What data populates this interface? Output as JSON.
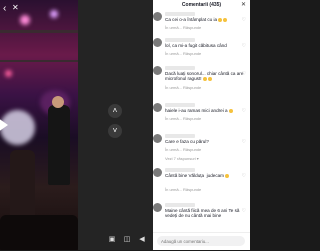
{
  "header": {
    "title": "Comentarii (435)"
  },
  "comments": [
    {
      "text": "Ca cei o-a întâmplat cu ia",
      "emoji": 2,
      "meta": "În urmă...   Răspunde"
    },
    {
      "text": "lol, ca mi-a fugit căbitusa când",
      "emoji": 0,
      "meta": "În urmă...   Răspunde"
    },
    {
      "text": "Dacă luați sonorul... chiar cântă ca are microfonul ragust!",
      "emoji": 2,
      "meta": "În urmă...   Răspunde"
    },
    {
      "text": "haiele i-au ramas mici andrei a",
      "emoji": 1,
      "meta": "În urmă...   Răspunde"
    },
    {
      "text": "Care e faza cu părul?",
      "emoji": 0,
      "meta": "În urmă...   Răspunde"
    },
    {
      "text": "Cântă bine Vălduța  judecam",
      "emoji": 1,
      "meta": "În urmă...   Răspunde"
    },
    {
      "text": "Maine cântă fiică mea de 6 ani Te să vedeți de nu cântă mai bine",
      "emoji": 0,
      "meta": ""
    }
  ],
  "view_replies": "Vezi 7 răspunsuri ▾",
  "comment_input": {
    "placeholder": "Adaugă un comentariu..."
  }
}
